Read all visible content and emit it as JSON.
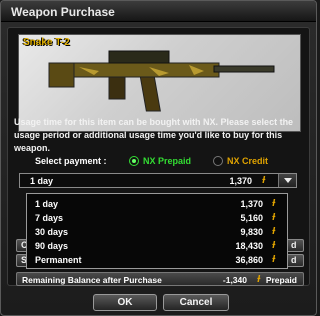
{
  "window": {
    "title": "Weapon Purchase"
  },
  "weapon": {
    "name": "Snake T-2"
  },
  "description": "Usage time for this item can be bought with NX.  Please select the usage period or additional usage time you'd like to buy for this weapon.",
  "payment": {
    "label": "Select payment :",
    "options": [
      {
        "label": "NX Prepaid",
        "selected": true,
        "color": "#33dd33"
      },
      {
        "label": "NX Credit",
        "selected": false,
        "color": "#e0a300"
      }
    ]
  },
  "select": {
    "label": "1 day",
    "price": "1,370",
    "currency_icon": "nx-icon"
  },
  "dropdown": {
    "options": [
      {
        "label": "1 day",
        "price": "1,370"
      },
      {
        "label": "7 days",
        "price": "5,160"
      },
      {
        "label": "30 days",
        "price": "9,830"
      },
      {
        "label": "90 days",
        "price": "18,430"
      },
      {
        "label": "Permanent",
        "price": "36,860"
      }
    ]
  },
  "balance": {
    "label": "Remaining Balance after Purchase",
    "value": "-1,340",
    "type": "Prepaid"
  },
  "buttons": {
    "ok": "OK",
    "cancel": "Cancel"
  },
  "currency_glyph": "Ɨ",
  "colors": {
    "accent": "#e0a300",
    "selected": "#33dd33"
  }
}
